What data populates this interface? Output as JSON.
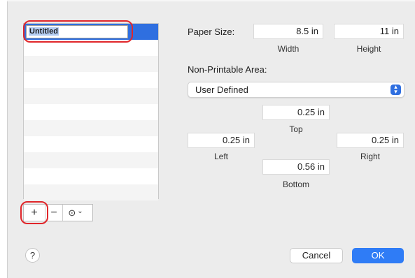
{
  "list": {
    "selected_name": "Untitled"
  },
  "list_controls": {
    "add_label": "+",
    "remove_label": "−",
    "actions_label": "⊙",
    "actions_chevron": "⌄"
  },
  "paper_size": {
    "label": "Paper Size:",
    "width_value": "8.5 in",
    "width_label": "Width",
    "height_value": "11 in",
    "height_label": "Height"
  },
  "non_printable": {
    "label": "Non-Printable Area:",
    "preset_selected": "User Defined",
    "top_value": "0.25 in",
    "top_label": "Top",
    "left_value": "0.25 in",
    "left_label": "Left",
    "right_value": "0.25 in",
    "right_label": "Right",
    "bottom_value": "0.56 in",
    "bottom_label": "Bottom"
  },
  "footer": {
    "help_label": "?",
    "cancel_label": "Cancel",
    "ok_label": "OK"
  },
  "colors": {
    "accent": "#2f7cf6",
    "callout": "#e0262a"
  }
}
